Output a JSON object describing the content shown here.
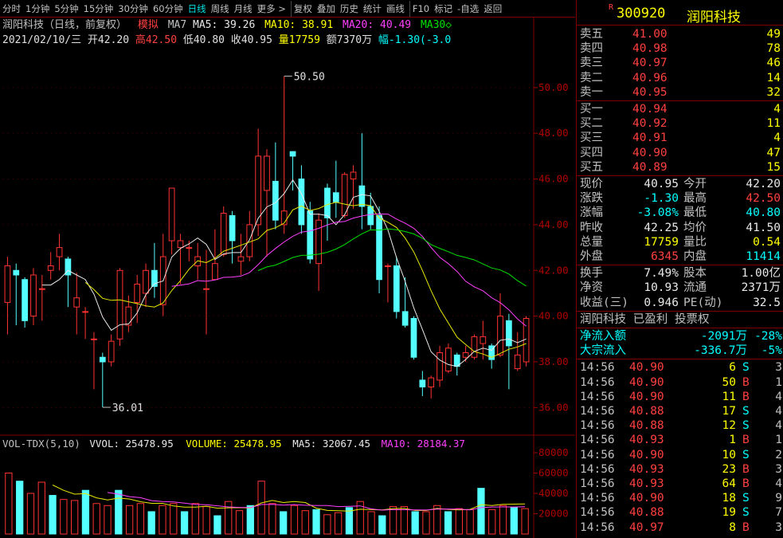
{
  "toolbar": [
    "分时",
    "1分钟",
    "5分钟",
    "15分钟",
    "30分钟",
    "60分钟",
    "日线",
    "周线",
    "月线",
    "更多 >",
    "复权",
    "叠加",
    "历史",
    "统计",
    "画线",
    "F10",
    "标记",
    "-自选",
    "返回"
  ],
  "toolbar_active": "日线",
  "info": {
    "name": "润阳科技（日线，前复权）",
    "mode": "模拟",
    "ma7": "MA7",
    "ma5": "MA5: 39.26",
    "ma10": "MA10: 38.91",
    "ma20": "MA20: 40.49",
    "ma30": "MA30◇"
  },
  "bar": {
    "date": "2021/02/10/三",
    "open": "开42.20",
    "high": "高42.50",
    "low": "低40.80",
    "close": "收40.95",
    "vol": "量17759",
    "amt": "额7370万",
    "chg": "幅-1.30(-3.0"
  },
  "volinfo": {
    "ind": "VOL-TDX(5,10)",
    "vvol": "VVOL: 25478.95",
    "volume": "VOLUME: 25478.95",
    "ma5": "MA5: 32067.45",
    "ma10": "MA10: 28184.37"
  },
  "chart_data": {
    "type": "candlestick",
    "price_ticks": [
      "50.00",
      "48.00",
      "46.00",
      "44.00",
      "42.00",
      "40.00",
      "38.00",
      "36.00"
    ],
    "ylim": [
      35.0,
      51.6
    ],
    "annotations": {
      "max": "50.50",
      "min": "36.01"
    },
    "candles": [
      [
        40.6,
        42.2,
        39.2,
        42.6
      ],
      [
        42.0,
        41.8,
        39.6,
        42.3
      ],
      [
        41.6,
        39.8,
        39.5,
        41.7
      ],
      [
        40.0,
        41.8,
        39.6,
        42.1
      ],
      [
        41.2,
        41.2,
        39.8,
        41.8
      ],
      [
        42.0,
        42.2,
        41.6,
        42.8
      ],
      [
        42.6,
        43.0,
        42.0,
        43.6
      ],
      [
        42.5,
        41.8,
        40.4,
        42.6
      ],
      [
        40.4,
        40.8,
        39.2,
        41.9
      ],
      [
        40.2,
        40.2,
        39.0,
        40.4
      ],
      [
        39.0,
        39.0,
        36.8,
        39.3
      ],
      [
        38.2,
        38.0,
        36.01,
        38.4
      ],
      [
        38.0,
        38.9,
        37.8,
        39.2
      ],
      [
        39.0,
        42.0,
        38.7,
        42.1
      ],
      [
        39.6,
        40.4,
        39.3,
        40.9
      ],
      [
        40.6,
        41.4,
        39.7,
        41.8
      ],
      [
        41.0,
        42.0,
        40.4,
        42.3
      ],
      [
        42.0,
        41.3,
        40.8,
        43.2
      ],
      [
        40.5,
        42.6,
        40.0,
        43.6
      ],
      [
        43.3,
        45.6,
        42.7,
        45.6
      ],
      [
        43.0,
        43.3,
        41.4,
        43.6
      ],
      [
        43.0,
        43.0,
        42.4,
        43.3
      ],
      [
        42.2,
        42.6,
        41.6,
        43.2
      ],
      [
        41.2,
        41.2,
        39.2,
        42.9
      ],
      [
        41.6,
        42.3,
        41.6,
        43.8
      ],
      [
        42.7,
        44.5,
        42.6,
        44.8
      ],
      [
        44.4,
        43.3,
        42.3,
        44.6
      ],
      [
        42.4,
        42.6,
        41.8,
        43.6
      ],
      [
        42.6,
        44.0,
        42.4,
        44.6
      ],
      [
        44.0,
        47.0,
        43.5,
        48.2
      ],
      [
        45.5,
        47.0,
        42.6,
        47.3
      ],
      [
        45.9,
        44.2,
        43.8,
        47.6
      ],
      [
        44.0,
        44.6,
        43.6,
        50.5
      ],
      [
        47.2,
        47.0,
        45.5,
        47.2
      ],
      [
        46.0,
        44.0,
        43.6,
        46.6
      ],
      [
        44.6,
        42.5,
        42.3,
        45.0
      ],
      [
        42.3,
        44.2,
        41.1,
        44.5
      ],
      [
        45.6,
        44.3,
        43.3,
        45.8
      ],
      [
        45.4,
        45.0,
        44.3,
        46.8
      ],
      [
        44.4,
        46.2,
        44.3,
        46.3
      ],
      [
        46.0,
        46.3,
        44.7,
        46.6
      ],
      [
        45.7,
        44.8,
        43.8,
        48.0
      ],
      [
        44.8,
        44.0,
        43.8,
        45.4
      ],
      [
        44.4,
        41.6,
        41.0,
        44.8
      ],
      [
        42.2,
        42.2,
        40.6,
        42.3
      ],
      [
        42.2,
        40.2,
        39.9,
        42.6
      ],
      [
        40.2,
        39.6,
        39.5,
        41.7
      ],
      [
        39.9,
        38.2,
        38.1,
        40.0
      ],
      [
        37.2,
        36.9,
        36.5,
        37.6
      ],
      [
        36.9,
        37.3,
        36.4,
        37.4
      ],
      [
        37.2,
        38.4,
        36.9,
        38.7
      ],
      [
        37.6,
        38.6,
        37.5,
        38.8
      ],
      [
        38.3,
        37.8,
        37.4,
        38.4
      ],
      [
        38.2,
        38.4,
        38.0,
        38.7
      ],
      [
        38.2,
        39.1,
        38.1,
        39.2
      ],
      [
        38.8,
        39.1,
        38.1,
        39.8
      ],
      [
        38.7,
        38.1,
        37.7,
        38.8
      ],
      [
        38.3,
        40.0,
        38.2,
        41.0
      ],
      [
        39.8,
        38.7,
        36.8,
        40.1
      ],
      [
        37.7,
        38.3,
        37.6,
        39.3
      ],
      [
        38.0,
        39.9,
        37.8,
        40.0
      ]
    ],
    "volumes": [
      60000,
      52000,
      40000,
      51000,
      38000,
      34000,
      33000,
      43000,
      30000,
      28000,
      43000,
      28000,
      30000,
      22000,
      28000,
      30000,
      22000,
      30000,
      27000,
      18000,
      32000,
      23000,
      28000,
      52000,
      30000,
      22000,
      28000,
      23000,
      24000,
      19000,
      21000,
      26000,
      32000,
      22000,
      18000,
      27000,
      27000,
      22000,
      22000,
      28000,
      22000,
      25000,
      24000,
      45000,
      24000,
      28000,
      26000,
      25000
    ],
    "vol_ticks": [
      "80000",
      "60000",
      "40000",
      "20000"
    ],
    "vol_ylim": [
      0,
      80000
    ]
  },
  "quote": {
    "code": "300920",
    "name": "润阳科技",
    "badge": "R",
    "sell": [
      [
        "卖五",
        "41.00",
        "49"
      ],
      [
        "卖四",
        "40.98",
        "78"
      ],
      [
        "卖三",
        "40.97",
        "46"
      ],
      [
        "卖二",
        "40.96",
        "14"
      ],
      [
        "卖一",
        "40.95",
        "32"
      ]
    ],
    "buy": [
      [
        "买一",
        "40.94",
        "4"
      ],
      [
        "买二",
        "40.92",
        "11"
      ],
      [
        "买三",
        "40.91",
        "4"
      ],
      [
        "买四",
        "40.90",
        "47"
      ],
      [
        "买五",
        "40.89",
        "15"
      ]
    ],
    "stats": [
      [
        "现价",
        "40.95",
        "今开",
        "42.20"
      ],
      [
        "涨跌",
        "-1.30",
        "最高",
        "42.50"
      ],
      [
        "涨幅",
        "-3.08%",
        "最低",
        "40.80"
      ],
      [
        "昨收",
        "42.25",
        "均价",
        "41.50"
      ],
      [
        "总量",
        "17759",
        "量比",
        "0.54"
      ],
      [
        "外盘",
        "6345",
        "内盘",
        "11414"
      ]
    ],
    "stats2": [
      [
        "换手",
        "7.49%",
        "股本",
        "1.00亿"
      ],
      [
        "净资",
        "10.93",
        "流通",
        "2371万"
      ],
      [
        "收益(三)",
        "0.946",
        "PE(动)",
        "32.5"
      ]
    ],
    "profit": "润阳科技 已盈利 投票权",
    "flow": [
      [
        "净流入额",
        "-2091万",
        "-28%"
      ],
      [
        "大宗流入",
        "-336.7万",
        "-5%"
      ]
    ],
    "ticks": [
      [
        "14:56",
        "40.90",
        "6",
        "S",
        "3"
      ],
      [
        "14:56",
        "40.90",
        "50",
        "B",
        "1"
      ],
      [
        "14:56",
        "40.90",
        "11",
        "B",
        "4"
      ],
      [
        "14:56",
        "40.88",
        "17",
        "S",
        "4"
      ],
      [
        "14:56",
        "40.88",
        "12",
        "S",
        "4"
      ],
      [
        "14:56",
        "40.93",
        "1",
        "B",
        "1"
      ],
      [
        "14:56",
        "40.90",
        "10",
        "S",
        "2"
      ],
      [
        "14:56",
        "40.93",
        "23",
        "B",
        "3"
      ],
      [
        "14:56",
        "40.93",
        "64",
        "B",
        "4"
      ],
      [
        "14:56",
        "40.90",
        "18",
        "S",
        "9"
      ],
      [
        "14:56",
        "40.88",
        "19",
        "S",
        "7"
      ],
      [
        "14:56",
        "40.97",
        "8",
        "B",
        "3"
      ]
    ]
  }
}
